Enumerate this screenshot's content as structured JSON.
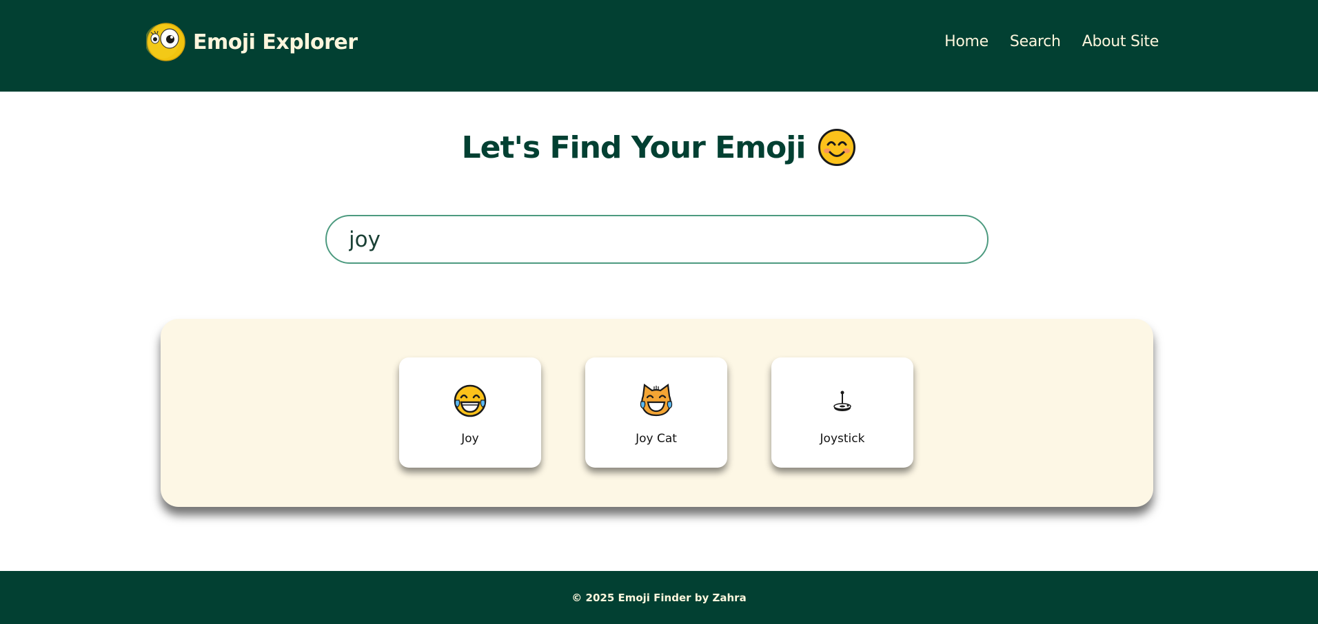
{
  "header": {
    "brand_name": "Emoji Explorer",
    "logo_icon": "googly-eye-emoji-icon",
    "nav": [
      {
        "label": "Home"
      },
      {
        "label": "Search"
      },
      {
        "label": "About Site"
      }
    ]
  },
  "main": {
    "title": "Let's Find Your Emoji",
    "title_icon": "smiling-face-emoji-icon",
    "search": {
      "value": "joy",
      "placeholder": ""
    },
    "results": [
      {
        "name": "Joy",
        "icon": "face-with-tears-of-joy-icon"
      },
      {
        "name": "Joy Cat",
        "icon": "cat-with-tears-of-joy-icon"
      },
      {
        "name": "Joystick",
        "icon": "joystick-icon"
      }
    ]
  },
  "footer": {
    "text": "© 2025 Emoji Finder by Zahra"
  },
  "colors": {
    "header_bg": "#024032",
    "header_text": "#fdf6dd",
    "title_text": "#024032",
    "search_border": "#4c9a7f",
    "results_bg": "#fdf7e5",
    "card_bg": "#ffffff"
  }
}
